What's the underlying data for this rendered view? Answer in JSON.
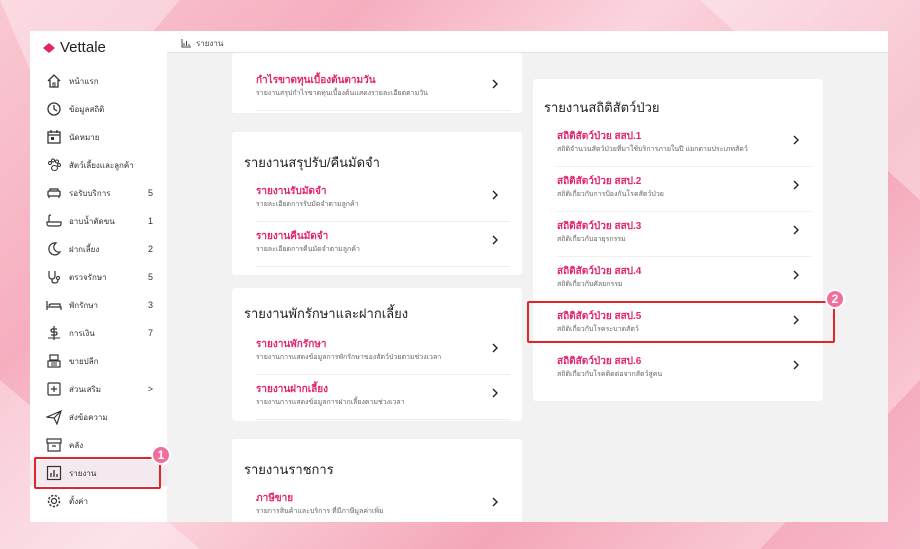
{
  "app": {
    "brand": "Vettale",
    "brand_color": "#e0266e"
  },
  "topbar": {
    "breadcrumb": "รายงาน"
  },
  "sidebar": {
    "items": [
      {
        "label": "หน้าแรก",
        "icon": "home-icon",
        "count": ""
      },
      {
        "label": "ข้อมูลสถิติ",
        "icon": "stats-icon",
        "count": ""
      },
      {
        "label": "นัดหมาย",
        "icon": "calendar-icon",
        "count": ""
      },
      {
        "label": "สัตว์เลี้ยงและลูกค้า",
        "icon": "paw-icon",
        "count": ""
      },
      {
        "label": "รอรับบริการ",
        "icon": "sofa-icon",
        "count": "5"
      },
      {
        "label": "อาบน้ำตัดขน",
        "icon": "bath-icon",
        "count": "1"
      },
      {
        "label": "ฝากเลี้ยง",
        "icon": "moon-icon",
        "count": "2"
      },
      {
        "label": "ตรวจรักษา",
        "icon": "stethoscope-icon",
        "count": "5"
      },
      {
        "label": "พักรักษา",
        "icon": "bed-icon",
        "count": "3"
      },
      {
        "label": "การเงิน",
        "icon": "money-icon",
        "count": "7"
      },
      {
        "label": "ขายปลีก",
        "icon": "register-icon",
        "count": ""
      },
      {
        "label": "ส่วนเสริม",
        "icon": "plus-box-icon",
        "count": ">"
      },
      {
        "label": "ส่งข้อความ",
        "icon": "send-icon",
        "count": ""
      },
      {
        "label": "คลัง",
        "icon": "archive-icon",
        "count": ""
      },
      {
        "label": "รายงาน",
        "icon": "chart-icon",
        "count": ""
      },
      {
        "label": "ตั้งค่า",
        "icon": "gear-icon",
        "count": ""
      }
    ]
  },
  "cards": {
    "profit": {
      "items": [
        {
          "name": "กำไรขาดทุนเบื้องต้นตามวัน",
          "desc": "รายงานสรุปกำไรขาดทุนเบื้องต้นแสดงรายละเอียดตามวัน"
        }
      ]
    },
    "deposit": {
      "title": "รายงานสรุปรับ/คืนมัดจำ",
      "items": [
        {
          "name": "รายงานรับมัดจำ",
          "desc": "รายละเอียดการรับมัดจำตามลูกค้า"
        },
        {
          "name": "รายงานคืนมัดจำ",
          "desc": "รายละเอียดการคืนมัดจำตามลูกค้า"
        }
      ]
    },
    "stay": {
      "title": "รายงานพักรักษาและฝากเลี้ยง",
      "items": [
        {
          "name": "รายงานพักรักษา",
          "desc": "รายงานการแสดงข้อมูลการพักรักษาของสัตว์ป่วยตามช่วงเวลา"
        },
        {
          "name": "รายงานฝากเลี้ยง",
          "desc": "รายงานการแสดงข้อมูลการฝากเลี้ยงตามช่วงเวลา"
        }
      ]
    },
    "gov": {
      "title": "รายงานราชการ",
      "items": [
        {
          "name": "ภาษีขาย",
          "desc": "รายการสินค้าและบริการ ที่มีภาษีมูลค่าเพิ่ม"
        }
      ]
    },
    "sick": {
      "title": "รายงานสถิติสัตว์ป่วย",
      "items": [
        {
          "name": "สถิติสัตว์ป่วย สสป.1",
          "desc": "สถิติจำนวนสัตว์ป่วยที่มาใช้บริการภายในปี แยกตามประเภทสัตว์"
        },
        {
          "name": "สถิติสัตว์ป่วย สสป.2",
          "desc": "สถิติเกี่ยวกับการป้องกันโรคสัตว์ป่วย"
        },
        {
          "name": "สถิติสัตว์ป่วย สสป.3",
          "desc": "สถิติเกี่ยวกับอายุรกรรม"
        },
        {
          "name": "สถิติสัตว์ป่วย สสป.4",
          "desc": "สถิติเกี่ยวกับศัลยกรรม"
        },
        {
          "name": "สถิติสัตว์ป่วย สสป.5",
          "desc": "สถิติเกี่ยวกับโรคระบาดสัตว์"
        },
        {
          "name": "สถิติสัตว์ป่วย สสป.6",
          "desc": "สถิติเกี่ยวกับโรคติดต่อจากสัตว์สู่คน"
        }
      ]
    }
  },
  "annotations": {
    "badge1": "1",
    "badge2": "2",
    "highlight_color": "#e2252b",
    "badge_color": "#f06d9d"
  }
}
